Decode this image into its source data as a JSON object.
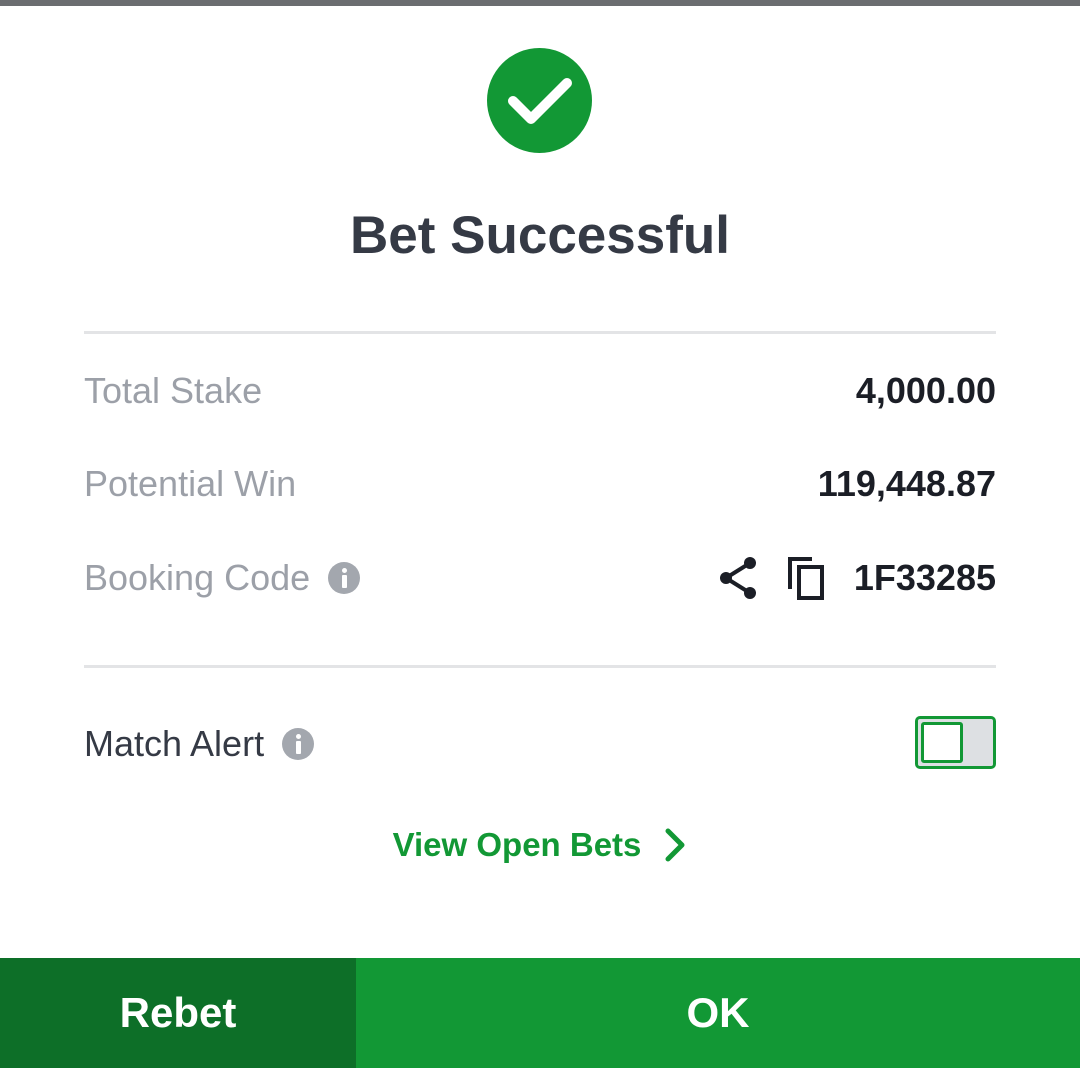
{
  "header": {
    "icon": "check-circle-icon",
    "title": "Bet Successful"
  },
  "summary": {
    "total_stake_label": "Total Stake",
    "total_stake_value": "4,000.00",
    "potential_win_label": "Potential Win",
    "potential_win_value": "119,448.87",
    "booking_code_label": "Booking Code",
    "booking_code_value": "1F33285"
  },
  "match_alert": {
    "label": "Match Alert",
    "enabled": false
  },
  "links": {
    "view_open_bets": "View Open Bets"
  },
  "footer": {
    "rebet_label": "Rebet",
    "ok_label": "OK"
  },
  "colors": {
    "accent_green": "#129835",
    "dark_green": "#0d6f28",
    "title_text": "#353a45",
    "muted_label": "#9ca0a8"
  }
}
